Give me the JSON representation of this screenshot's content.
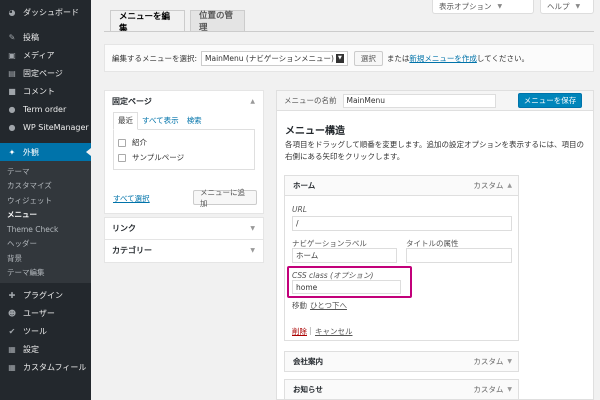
{
  "sidebar": {
    "top": [
      {
        "label": "ダッシュボード",
        "icon": "dashboard-icon"
      }
    ],
    "main": [
      {
        "label": "投稿",
        "icon": "pin-icon"
      },
      {
        "label": "メディア",
        "icon": "media-icon"
      },
      {
        "label": "固定ページ",
        "icon": "page-icon"
      },
      {
        "label": "コメント",
        "icon": "comment-icon"
      },
      {
        "label": "Term order",
        "icon": "term-order-icon"
      },
      {
        "label": "WP SiteManager",
        "icon": "sitemanager-icon"
      }
    ],
    "current": {
      "label": "外観",
      "icon": "appearance-icon"
    },
    "submenu": [
      "テーマ",
      "カスタマイズ",
      "ウィジェット",
      "メニュー",
      "Theme Check",
      "ヘッダー",
      "背景",
      "テーマ編集"
    ],
    "submenu_active_index": 3,
    "bottom": [
      {
        "label": "プラグイン",
        "icon": "plugin-icon"
      },
      {
        "label": "ユーザー",
        "icon": "user-icon"
      },
      {
        "label": "ツール",
        "icon": "tool-icon"
      },
      {
        "label": "設定",
        "icon": "settings-icon"
      },
      {
        "label": "カスタムフィール",
        "icon": "custom-field-icon"
      }
    ]
  },
  "screen_options": "表示オプション",
  "help": "ヘルプ",
  "tabs": [
    "メニューを編集",
    "位置の管理"
  ],
  "select_bar": {
    "label": "編集するメニューを選択:",
    "selected": "MainMenu (ナビゲーションメニュー)",
    "select_button": "選択",
    "or_text": "または",
    "create_link": "新規メニューを作成",
    "suffix": "してください。"
  },
  "left": {
    "pages_title": "固定ページ",
    "page_tabs": [
      "最近",
      "すべて表示",
      "検索"
    ],
    "pages": [
      "紹介",
      "サンプルページ"
    ],
    "select_all": "すべて選択",
    "add_button": "メニューに追加",
    "links_title": "リンク",
    "categories_title": "カテゴリー"
  },
  "right": {
    "menu_name_label": "メニューの名前",
    "menu_name_value": "MainMenu",
    "save_button": "メニューを保存",
    "structure_title": "メニュー構造",
    "description": "各項目をドラッグして順番を変更します。追加の設定オプションを表示するには、項目の右側にある矢印をクリックします。",
    "item_type": "カスタム",
    "expanded_item": {
      "title": "ホーム",
      "url_label": "URL",
      "url_value": "/",
      "nav_label": "ナビゲーションラベル",
      "nav_value": "ホーム",
      "title_attr_label": "タイトルの属性",
      "title_attr_value": "",
      "css_label": "CSS class (オプション)",
      "css_value": "home",
      "move_label": "移動",
      "move_link": "ひとつ下へ",
      "delete": "削除",
      "separator": "|",
      "cancel": "キャンセル"
    },
    "other_items": [
      "会社案内",
      "お知らせ"
    ]
  },
  "colors": {
    "sidebar_bg": "#23282d",
    "accent": "#0073aa",
    "highlight_border": "#c2007a"
  }
}
